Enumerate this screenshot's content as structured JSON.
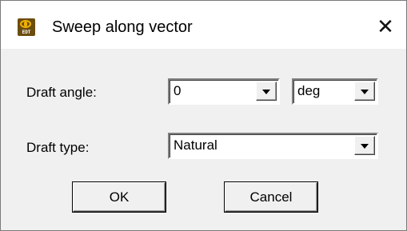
{
  "window": {
    "title": "Sweep along vector",
    "icon_name": "edt-app-icon",
    "icon_text": "EDT",
    "close_glyph": "✕"
  },
  "form": {
    "draft_angle": {
      "label": "Draft angle:",
      "value": "0",
      "unit": "deg"
    },
    "draft_type": {
      "label": "Draft type:",
      "value": "Natural"
    }
  },
  "buttons": {
    "ok_label": "OK",
    "cancel_label": "Cancel"
  }
}
